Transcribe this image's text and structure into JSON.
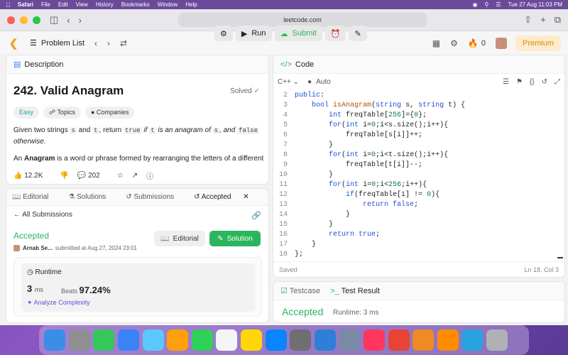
{
  "menubar": {
    "app": "Safari",
    "items": [
      "File",
      "Edit",
      "View",
      "History",
      "Bookmarks",
      "Window",
      "Help"
    ],
    "datetime": "Tue 27 Aug  11:03 PM"
  },
  "browser": {
    "url": "leetcode.com"
  },
  "lcnav": {
    "problem_list": "Problem List",
    "run": "Run",
    "submit": "Submit",
    "points": "0",
    "premium": "Premium"
  },
  "description": {
    "tab_label": "Description",
    "title": "242. Valid Anagram",
    "status": "Solved",
    "chips": [
      "Easy",
      "Topics",
      "Companies"
    ],
    "p1": {
      "a": "Given two strings",
      "s": "s",
      "and": "and",
      "t": "t",
      "b": ", return",
      "true": "true",
      "c": "if",
      "t2": "t",
      "d": "is an anagram of",
      "s2": "s",
      "e": ", and",
      "false": "false",
      "f": "otherwise."
    },
    "p2": {
      "a": "An",
      "anagram": "Anagram",
      "b": "is a word or phrase formed by rearranging the letters of a different"
    },
    "likes": "12.2K",
    "comments": "202"
  },
  "submissions": {
    "tabs": [
      "Editorial",
      "Solutions",
      "Submissions",
      "Accepted"
    ],
    "all_submissions": "All Submissions",
    "status": "Accepted",
    "author": "Arnab Se...",
    "submitted_at": "submitted at Aug 27, 2024 23:01",
    "editorial_btn": "Editorial",
    "solution_btn": "Solution",
    "runtime_label": "Runtime",
    "runtime_value": "3",
    "runtime_unit": "ms",
    "beats_label": "Beats",
    "beats_value": "97.24%",
    "analyze": "Analyze Complexity"
  },
  "code": {
    "tab_label": "Code",
    "language": "C++",
    "mode": "Auto",
    "saved": "Saved",
    "cursor": "Ln 18, Col 3",
    "lines": [
      {
        "n": "2",
        "text": "public:"
      },
      {
        "n": "3",
        "text": "    bool isAnagram(string s, string t) {"
      },
      {
        "n": "4",
        "text": "        int freqTable[256]={0};"
      },
      {
        "n": "5",
        "text": "        for(int i=0;i<s.size();i++){"
      },
      {
        "n": "6",
        "text": "            freqTable[s[i]]++;"
      },
      {
        "n": "7",
        "text": "        }"
      },
      {
        "n": "8",
        "text": "        for(int i=0;i<t.size();i++){"
      },
      {
        "n": "9",
        "text": "            freqTable[t[i]]--;"
      },
      {
        "n": "10",
        "text": "        }"
      },
      {
        "n": "11",
        "text": "        for(int i=0;i<256;i++){"
      },
      {
        "n": "12",
        "text": "            if(freqTable[i] != 0){"
      },
      {
        "n": "13",
        "text": "                return false;"
      },
      {
        "n": "14",
        "text": "            }"
      },
      {
        "n": "15",
        "text": "        }"
      },
      {
        "n": "16",
        "text": "        return true;"
      },
      {
        "n": "17",
        "text": "    }"
      },
      {
        "n": "18",
        "text": "};"
      }
    ]
  },
  "testpanel": {
    "testcase_tab": "Testcase",
    "result_tab": "Test Result",
    "status": "Accepted",
    "runtime": "Runtime: 3 ms"
  },
  "dock": {
    "apps": [
      "Finder",
      "Launchpad",
      "Messages",
      "Mail",
      "Maps",
      "Photos",
      "FaceTime",
      "Reminders",
      "Notes",
      "App Store",
      "System Settings",
      "VS Code",
      "Preview",
      "Music",
      "Chrome",
      "Infuse",
      "VLC",
      "Telegram",
      "Trash"
    ],
    "colors": [
      "#3a8ee6",
      "#8e8e93",
      "#34c759",
      "#3b82f6",
      "#5ac8fa",
      "#ff9f0a",
      "#30d158",
      "#f5f5f5",
      "#ffd60a",
      "#0a84ff",
      "#6e6e73",
      "#2f7fd8",
      "#7a8aa6",
      "#ff375f",
      "#e94335",
      "#f08a24",
      "#ff8c00",
      "#2aa3e0",
      "#b0b0b5"
    ]
  }
}
